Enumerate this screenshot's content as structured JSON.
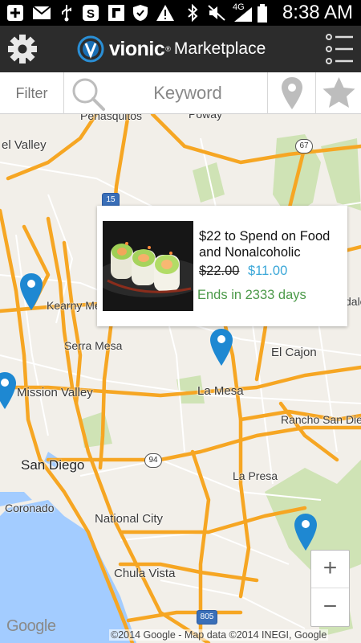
{
  "status_bar": {
    "time": "8:38 AM",
    "network": "4G",
    "icons": [
      "plus-icon",
      "mail-icon",
      "usb-icon",
      "app-s-icon",
      "flipboard-icon",
      "shield-icon",
      "warning-icon",
      "bluetooth-icon",
      "mute-icon",
      "signal-icon",
      "battery-icon"
    ]
  },
  "header": {
    "brand": "vionic",
    "brand_sup": "®",
    "brand_suffix": "Marketplace"
  },
  "search": {
    "filter_label": "Filter",
    "keyword_placeholder": "Keyword"
  },
  "map": {
    "labels": {
      "penasquitos": "Penasquitos",
      "poway": "Poway",
      "el_valley": "el Valley",
      "kearny_mesa": "Kearny Me",
      "serra_mesa": "Serra Mesa",
      "el_cajon": "El Cajon",
      "mission_valley": "Mission Valley",
      "la_mesa": "La Mesa",
      "rancho_san_diego": "Rancho San Die",
      "san_diego": "San Diego",
      "la_presa": "La Presa",
      "coronado": "Coronado",
      "national_city": "National City",
      "chula_vista": "Chula Vista",
      "edge_lakeside": "dale"
    },
    "shields": {
      "r67": "67",
      "i15": "15",
      "r94": "94",
      "i805": "805"
    },
    "google_logo": "Google",
    "attribution": "©2014 Google - Map data ©2014 INEGI, Google",
    "zoom_in": "+",
    "zoom_out": "−"
  },
  "deal_popup": {
    "title": "$22 to Spend on Food and Nonalcoholic",
    "price_original": "$22.00",
    "price_sale": "$11.00",
    "ends_text": "Ends in 2333 days"
  },
  "colors": {
    "header_bg": "#2c2c2c",
    "road": "#f6a623",
    "pin": "#1e88d2",
    "water": "#a3ccff",
    "park": "#cfe3b5",
    "sale_price": "#3aa7d8",
    "ends_text": "#4c9a4a"
  }
}
